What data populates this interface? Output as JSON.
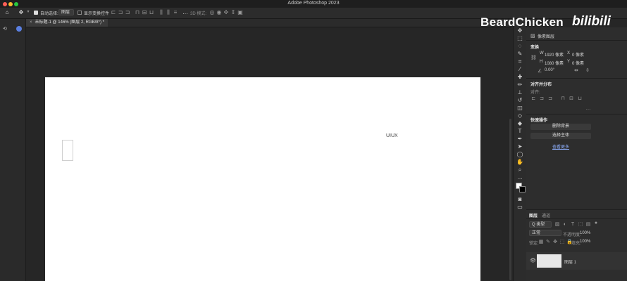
{
  "titlebar": {
    "app_title": "Adobe Photoshop 2023",
    "traffic_colors": [
      "#ff5f57",
      "#febc2e",
      "#28c840"
    ]
  },
  "options_bar": {
    "auto_select_label": "自动选择:",
    "auto_select_value": "图层",
    "show_transform_label": "显示变换控件",
    "mode_3d_label": "3D 模式:"
  },
  "document": {
    "tab_title": "未标题-1 @ 146% (图层 2, RGB/8*) *"
  },
  "canvas": {
    "text_layer": "UIUX"
  },
  "watermark": {
    "channel": "BeardChicken",
    "platform": "bilibili"
  },
  "properties_panel": {
    "layer_kind": "像素图层",
    "transform_title": "变换",
    "w_label": "W",
    "w_value": "1920 像素",
    "h_label": "H",
    "h_value": "1080 像素",
    "x_label": "X",
    "x_value": "0 像素",
    "y_label": "Y",
    "y_value": "0 像素",
    "angle_value": "0.00°",
    "align_title": "对齐并分布",
    "align_label": "对齐:",
    "quick_actions_title": "快速操作",
    "remove_bg": "删除背景",
    "select_subject": "选择主体",
    "learn_more": "查看更多"
  },
  "layers_panel": {
    "tabs": [
      "图层",
      "通道"
    ],
    "filter_kind": "Q 类型",
    "blend_mode": "正常",
    "opacity_label": "不透明度:",
    "opacity_value": "100%",
    "lock_label": "锁定:",
    "fill_label": "填充:",
    "fill_value": "100%",
    "layer_name": "图层 1"
  }
}
